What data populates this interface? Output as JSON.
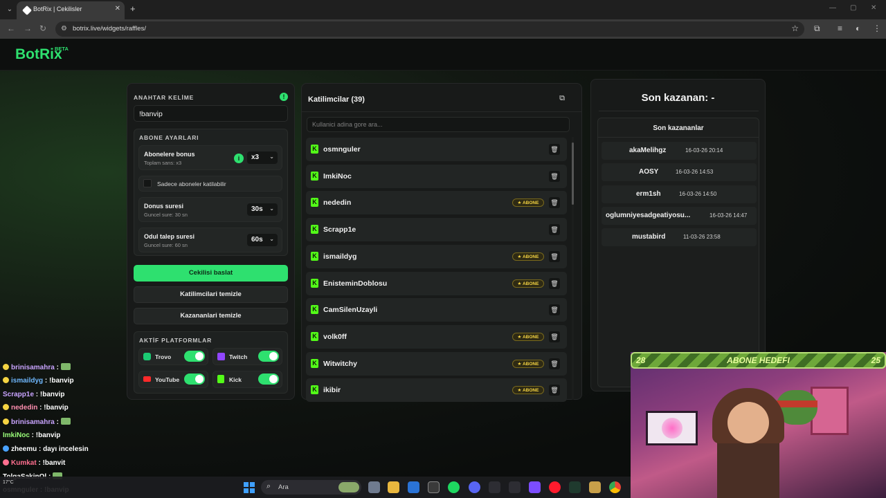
{
  "browser": {
    "tab_title": "BotRix | Cekilisler",
    "url": "botrix.live/widgets/raffles/"
  },
  "site": {
    "logo": "BotRix",
    "beta": "BETA"
  },
  "settings": {
    "keyword_label": "ANAHTAR KELİME",
    "keyword_value": "!banvip",
    "sub_settings_label": "ABONE AYARLARI",
    "sub_bonus_title": "Abonelere bonus",
    "sub_bonus_sub": "Toplam sans: x3",
    "sub_bonus_value": "x3",
    "only_subs_label": "Sadece aboneler katilabilir",
    "bonus_duration_title": "Donus suresi",
    "bonus_duration_sub": "Guncel sure: 30 sn",
    "bonus_duration_value": "30s",
    "claim_duration_title": "Odul talep suresi",
    "claim_duration_sub": "Guncel sure: 60 sn",
    "claim_duration_value": "60s",
    "start_button": "Cekilisi baslat",
    "clear_participants_button": "Katilimcilari temizle",
    "clear_winners_button": "Kazananlari temizle",
    "platforms_label": "AKTİF PLATFORMLAR",
    "platforms": [
      "Trovo",
      "Twitch",
      "YouTube",
      "Kick"
    ]
  },
  "participants": {
    "title": "Katilimcilar (39)",
    "search_placeholder": "Kullanici adina gore ara...",
    "badge_label": "ABONE",
    "list": [
      {
        "name": "osmnguler",
        "sub": false
      },
      {
        "name": "ImkiNoc",
        "sub": false
      },
      {
        "name": "nededin",
        "sub": true
      },
      {
        "name": "Scrapp1e",
        "sub": false
      },
      {
        "name": "ismaildyg",
        "sub": true
      },
      {
        "name": "EnisteminDoblosu",
        "sub": true
      },
      {
        "name": "CamSilenUzayli",
        "sub": false
      },
      {
        "name": "volk0ff",
        "sub": true
      },
      {
        "name": "Witwitchy",
        "sub": true
      },
      {
        "name": "ikibir",
        "sub": true
      }
    ]
  },
  "winners": {
    "last_winner": "Son kazanan: -",
    "recent_title": "Son kazananlar",
    "list": [
      {
        "name": "akaMelihgz",
        "time": "16-03-26 20:14"
      },
      {
        "name": "AOSY",
        "time": "16-03-26 14:53"
      },
      {
        "name": "erm1sh",
        "time": "16-03-26 14:50"
      },
      {
        "name": "oglumniyesadgeatiyosu...",
        "time": "16-03-26 14:47"
      },
      {
        "name": "mustabird",
        "time": "11-03-26 23:58"
      }
    ]
  },
  "chat": [
    {
      "user": "brinisamahra",
      "msg": "",
      "color": "#c9a4ff"
    },
    {
      "user": "ismaildyg",
      "msg": "!banvip",
      "color": "#6fb8ff"
    },
    {
      "user": "Scrapp1e",
      "msg": "!banvip",
      "color": "#c9a4ff"
    },
    {
      "user": "nededin",
      "msg": "!banvip",
      "color": "#ff8fb0"
    },
    {
      "user": "brinisamahra",
      "msg": "",
      "color": "#c9a4ff"
    },
    {
      "user": "ImkiNoc",
      "msg": "!banvip",
      "color": "#9bff7a"
    },
    {
      "user": "zheemu",
      "msg": "dayı incelesin",
      "color": "#ffffff"
    },
    {
      "user": "Kumkat",
      "msg": "!banvit",
      "color": "#ff6f8f"
    },
    {
      "user": "TolgaSakinOl",
      "msg": "",
      "color": "#ffffff"
    },
    {
      "user": "osmnguler",
      "msg": "!banvip",
      "color": "#ffffff"
    }
  ],
  "goal": {
    "left": "28",
    "title": "ABONE HEDEFI",
    "right": "25"
  },
  "taskbar": {
    "search": "Ara",
    "weather": "17°C"
  }
}
